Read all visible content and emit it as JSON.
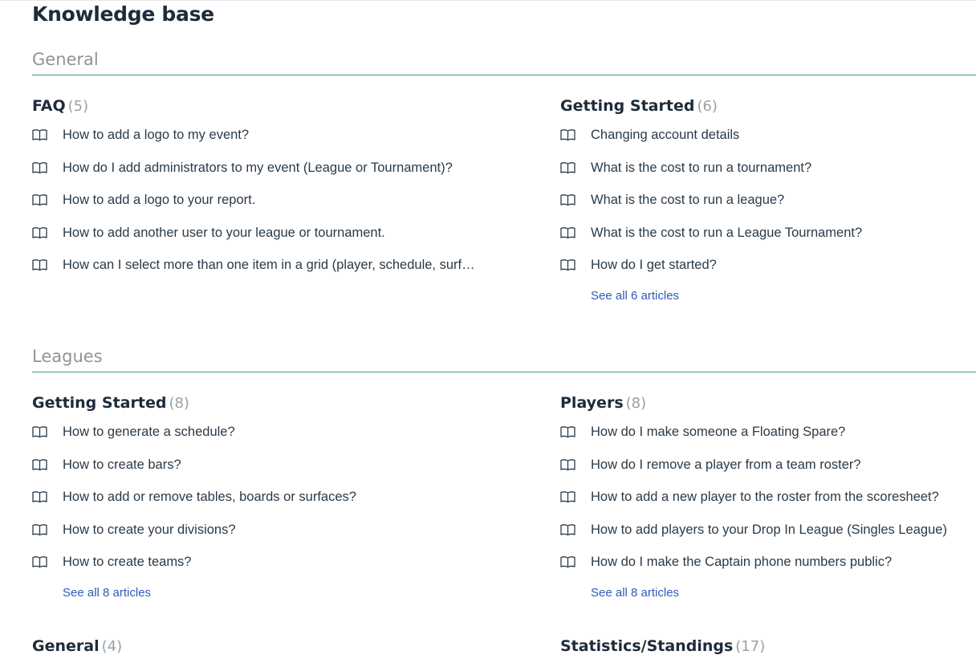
{
  "page": {
    "title": "Knowledge base"
  },
  "sections": [
    {
      "title": "General",
      "categories": [
        {
          "name": "FAQ",
          "count": "(5)",
          "articles": [
            "How to add a logo to my event?",
            "How do I add administrators to my event (League or Tournament)?",
            "How to add a logo to your report.",
            "How to add another user to your league or tournament.",
            "How can I select more than one item in a grid (player, schedule, surface, etc.)?"
          ]
        },
        {
          "name": "Getting Started",
          "count": "(6)",
          "articles": [
            "Changing account details",
            "What is the cost to run a tournament?",
            "What is the cost to run a league?",
            "What is the cost to run a League Tournament?",
            "How do I get started?"
          ],
          "see_all": "See all 6 articles"
        }
      ]
    },
    {
      "title": "Leagues",
      "categories": [
        {
          "name": "Getting Started",
          "count": "(8)",
          "articles": [
            "How to generate a schedule?",
            "How to create bars?",
            "How to add or remove tables, boards or surfaces?",
            "How to create your divisions?",
            "How to create teams?"
          ],
          "see_all": "See all 8 articles"
        },
        {
          "name": "Players",
          "count": "(8)",
          "articles": [
            "How do I make someone a Floating Spare?",
            "How do I remove a player from a team roster?",
            "How to add a new player to the roster from the scoresheet?",
            "How to add players to your Drop In League (Singles League)",
            "How do I make the Captain phone numbers public?"
          ],
          "see_all": "See all 8 articles"
        },
        {
          "name": "General",
          "count": "(4)"
        },
        {
          "name": "Statistics/Standings",
          "count": "(17)"
        }
      ]
    }
  ],
  "icons": {
    "article": "book-open-icon"
  },
  "colors": {
    "heading": "#1d2b3a",
    "section_title": "#8f959b",
    "section_rule": "#3d9a96",
    "link": "#2f5cb8",
    "count": "#9aa0a6"
  }
}
